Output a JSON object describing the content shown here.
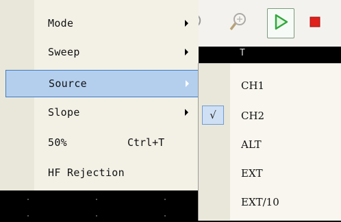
{
  "main_menu": {
    "items": [
      {
        "label": "Mode",
        "shortcut": "",
        "has_submenu": true,
        "highlighted": false
      },
      {
        "label": "Sweep",
        "shortcut": "",
        "has_submenu": true,
        "highlighted": false
      },
      {
        "label": "Source",
        "shortcut": "",
        "has_submenu": true,
        "highlighted": true
      },
      {
        "label": "Slope",
        "shortcut": "",
        "has_submenu": true,
        "highlighted": false
      },
      {
        "label": "50%",
        "shortcut": "Ctrl+T",
        "has_submenu": false,
        "highlighted": false
      },
      {
        "label": "HF Rejection",
        "shortcut": "",
        "has_submenu": false,
        "highlighted": false
      }
    ]
  },
  "source_submenu": {
    "items": [
      {
        "label": "CH1",
        "checked": false
      },
      {
        "label": "CH2",
        "checked": true
      },
      {
        "label": "ALT",
        "checked": false
      },
      {
        "label": "EXT",
        "checked": false
      },
      {
        "label": "EXT/10",
        "checked": false
      }
    ],
    "check_glyph": "√"
  },
  "scope": {
    "t_label": "T"
  },
  "toolbar": {
    "icons": [
      "zoom-out-icon",
      "zoom-in-icon",
      "run-icon",
      "stop-icon"
    ]
  },
  "colors": {
    "menu_bg": "#f3f1e6",
    "gutter": "#e9e7d9",
    "highlight_bg": "#b4cfee",
    "highlight_border": "#3f7bc4",
    "run_green": "#2fa83a",
    "stop_red": "#e0201a"
  }
}
